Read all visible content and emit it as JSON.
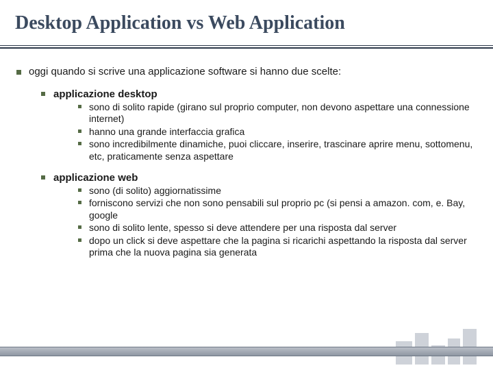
{
  "title": "Desktop Application vs Web Application",
  "intro": "oggi quando si scrive una applicazione software si hanno due scelte:",
  "sections": [
    {
      "heading": "applicazione desktop",
      "items": [
        "sono di solito rapide (girano sul proprio computer, non devono aspettare una connessione internet)",
        "hanno una grande interfaccia grafica",
        "sono incredibilmente dinamiche, puoi cliccare, inserire, trascinare aprire menu, sottomenu, etc, praticamente senza aspettare"
      ]
    },
    {
      "heading": "applicazione web",
      "items": [
        "sono (di solito) aggiornatissime",
        "forniscono servizi che non sono pensabili sul proprio pc (si pensi a amazon. com, e. Bay, google",
        "sono di solito lente, spesso si deve attendere per una risposta dal server",
        "dopo un click si deve aspettare che la pagina si ricarichi aspettando la risposta dal server prima che la nuova pagina sia generata"
      ]
    }
  ]
}
